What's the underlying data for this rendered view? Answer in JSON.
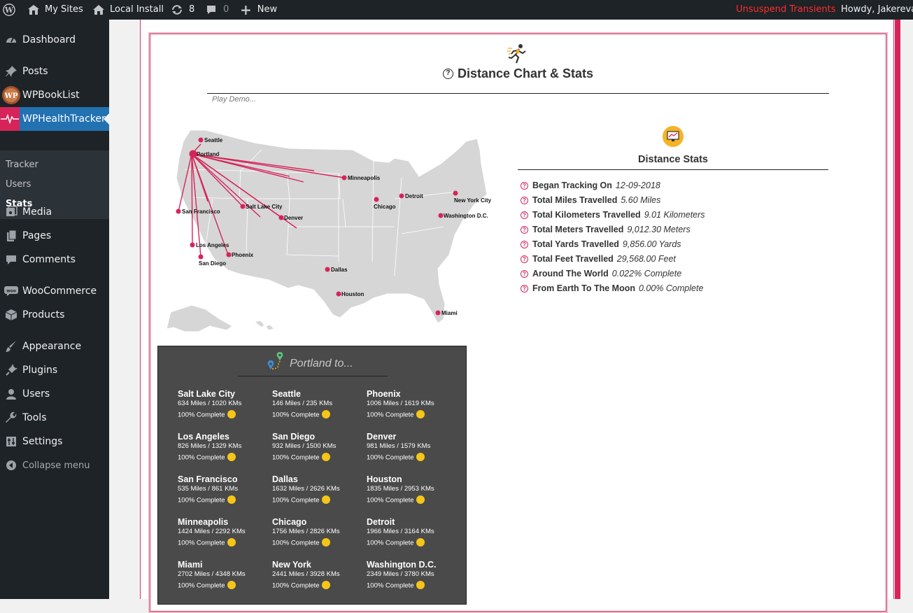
{
  "adminbar": {
    "my_sites": "My Sites",
    "site_name": "Local Install",
    "updates_count": "8",
    "comments_count": "0",
    "new_label": "New",
    "unsuspend": "Unsuspend Transients",
    "howdy": "Howdy, Jakereva",
    "colors": {
      "bar": "#1d2327",
      "alert": "#ff2d2d"
    }
  },
  "sidebar": {
    "items": [
      {
        "label": "Dashboard",
        "icon": "dashboard-icon"
      },
      {
        "label": "Posts",
        "icon": "pin-icon"
      },
      {
        "label": "WPBookList",
        "icon": "wpbooklist-logo-icon"
      },
      {
        "label": "WPHealthTracker",
        "icon": "heartbeat-icon"
      },
      {
        "label": "Media",
        "icon": "media-icon"
      },
      {
        "label": "Pages",
        "icon": "pages-icon"
      },
      {
        "label": "Comments",
        "icon": "comment-icon"
      },
      {
        "label": "WooCommerce",
        "icon": "woo-icon"
      },
      {
        "label": "Products",
        "icon": "box-icon"
      },
      {
        "label": "Appearance",
        "icon": "brush-icon"
      },
      {
        "label": "Plugins",
        "icon": "plug-icon"
      },
      {
        "label": "Users",
        "icon": "user-icon"
      },
      {
        "label": "Tools",
        "icon": "wrench-icon"
      },
      {
        "label": "Settings",
        "icon": "sliders-icon"
      },
      {
        "label": "Collapse menu",
        "icon": "collapse-icon"
      }
    ],
    "submenu": [
      "Tracker",
      "Users",
      "Stats"
    ],
    "active_color": "#2271b1"
  },
  "main": {
    "title": "Distance Chart & Stats",
    "demo_link": "Play Demo...",
    "accent": "#d6245a"
  },
  "map": {
    "labels": [
      "Seattle",
      "Portland",
      "San Francisco",
      "Salt Lake City",
      "Denver",
      "Los Angeles",
      "Phoenix",
      "San Diego",
      "Minneapolis",
      "Chicago",
      "Detroit",
      "New York City",
      "Washington D.C.",
      "Dallas",
      "Houston",
      "Miami"
    ]
  },
  "stats": {
    "heading": "Distance Stats",
    "rows": [
      {
        "key": "Began Tracking On",
        "value": "12-09-2018"
      },
      {
        "key": "Total Miles Travelled",
        "value": "5.60 Miles"
      },
      {
        "key": "Total Kilometers Travelled",
        "value": "9.01 Kilometers"
      },
      {
        "key": "Total Meters Travelled",
        "value": "9,012.30 Meters"
      },
      {
        "key": "Total Yards Travelled",
        "value": "9,856.00 Yards"
      },
      {
        "key": "Total Feet Travelled",
        "value": "29,568.00 Feet"
      },
      {
        "key": "Around The World",
        "value": "0.022% Complete"
      },
      {
        "key": "From Earth To The Moon",
        "value": "0.00% Complete"
      }
    ]
  },
  "portland": {
    "heading": "Portland to...",
    "cities": [
      {
        "name": "Salt Lake City",
        "dist": "634 Miles / 1020 KMs",
        "pct": "100% Complete"
      },
      {
        "name": "Seattle",
        "dist": "146 Miles / 235 KMs",
        "pct": "100% Complete"
      },
      {
        "name": "Phoenix",
        "dist": "1006 Miles / 1619 KMs",
        "pct": "100% Complete"
      },
      {
        "name": "Los Angeles",
        "dist": "826 Miles / 1329 KMs",
        "pct": "100% Complete"
      },
      {
        "name": "San Diego",
        "dist": "932 Miles / 1500 KMs",
        "pct": "100% Complete"
      },
      {
        "name": "Denver",
        "dist": "981 Miles / 1579 KMs",
        "pct": "100% Complete"
      },
      {
        "name": "San Francisco",
        "dist": "535 Miles / 861 KMs",
        "pct": "100% Complete"
      },
      {
        "name": "Dallas",
        "dist": "1632 Miles / 2626 KMs",
        "pct": "100% Complete"
      },
      {
        "name": "Houston",
        "dist": "1835 Miles / 2953 KMs",
        "pct": "100% Complete"
      },
      {
        "name": "Minneapolis",
        "dist": "1424 Miles / 2292 KMs",
        "pct": "100% Complete"
      },
      {
        "name": "Chicago",
        "dist": "1756 Miles / 2826 KMs",
        "pct": "100% Complete"
      },
      {
        "name": "Detroit",
        "dist": "1966 Miles / 3164 KMs",
        "pct": "100% Complete"
      },
      {
        "name": "Miami",
        "dist": "2702 Miles / 4348 KMs",
        "pct": "100% Complete"
      },
      {
        "name": "New York",
        "dist": "2441 Miles / 3928 KMs",
        "pct": "100% Complete"
      },
      {
        "name": "Washington D.C.",
        "dist": "2349 Miles / 3780 KMs",
        "pct": "100% Complete"
      }
    ]
  }
}
